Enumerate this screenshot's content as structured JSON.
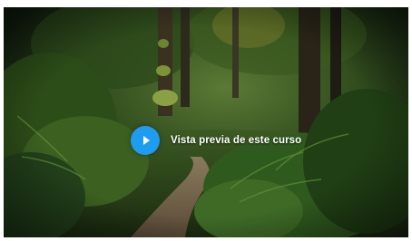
{
  "video": {
    "preview_label": "Vista previa de este curso",
    "play_icon": "play-icon",
    "accent_color": "#1e9cf0"
  }
}
